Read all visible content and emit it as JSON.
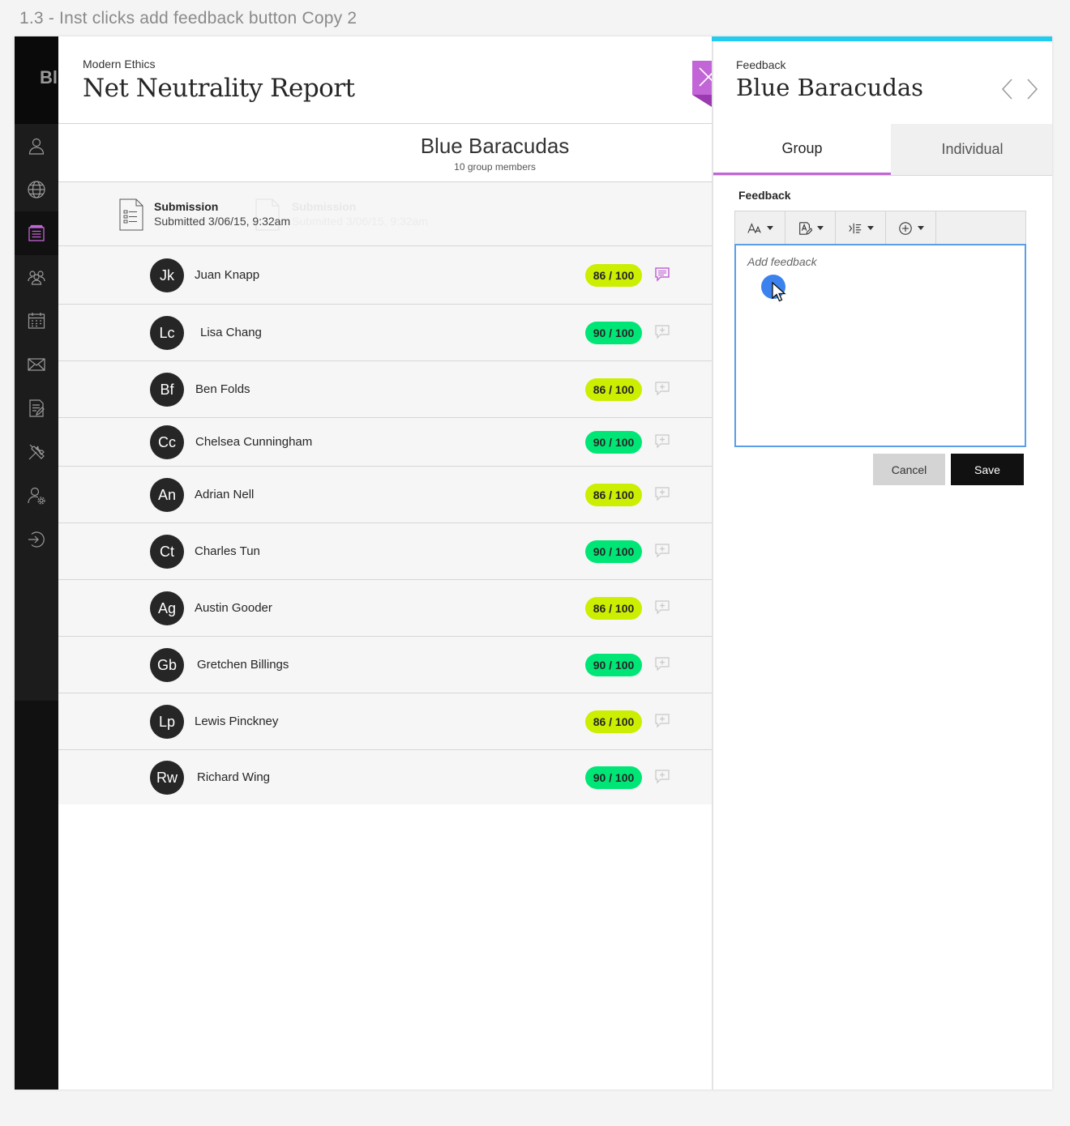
{
  "artboard": {
    "title": "1.3 - Inst clicks add feedback button Copy 2"
  },
  "nav": {
    "brand_text": "Bl",
    "items": [
      {
        "icon": "user-icon"
      },
      {
        "icon": "globe-icon"
      },
      {
        "icon": "courses-icon",
        "active": true
      },
      {
        "icon": "groups-icon"
      },
      {
        "icon": "calendar-icon"
      },
      {
        "icon": "mail-icon"
      },
      {
        "icon": "grades-icon"
      },
      {
        "icon": "tools-icon"
      },
      {
        "icon": "user-settings-icon"
      },
      {
        "icon": "sign-out-icon"
      }
    ]
  },
  "header": {
    "course": "Modern Ethics",
    "title": "Net Neutrality Report"
  },
  "group": {
    "name": "Blue Baracudas",
    "members": "10 group members"
  },
  "submission": {
    "title": "Submission",
    "date": "Submitted 3/06/15, 9:32am"
  },
  "students": [
    {
      "initials": "Jk",
      "name": "Juan Knapp",
      "grade": "86 / 100",
      "has_feedback": true
    },
    {
      "initials": "Lc",
      "name": "Lisa Chang",
      "grade": "90 / 100",
      "has_feedback": false
    },
    {
      "initials": "Bf",
      "name": "Ben Folds",
      "grade": "86 / 100",
      "has_feedback": false
    },
    {
      "initials": "Cc",
      "name": "Chelsea Cunningham",
      "grade": "90 / 100",
      "has_feedback": false
    },
    {
      "initials": "An",
      "name": "Adrian Nell",
      "grade": "86 / 100",
      "has_feedback": false
    },
    {
      "initials": "Ct",
      "name": "Charles Tun",
      "grade": "90 / 100",
      "has_feedback": false
    },
    {
      "initials": "Ag",
      "name": "Austin Gooder",
      "grade": "86 / 100",
      "has_feedback": false
    },
    {
      "initials": "Gb",
      "name": "Gretchen Billings",
      "grade": "90 / 100",
      "has_feedback": false
    },
    {
      "initials": "Lp",
      "name": "Lewis Pinckney",
      "grade": "86 / 100",
      "has_feedback": false
    },
    {
      "initials": "Rw",
      "name": "Richard Wing",
      "grade": "90 / 100",
      "has_feedback": false
    }
  ],
  "colors": {
    "grade_86": "#ccee00",
    "grade_90": "#00e676",
    "accent_purple": "#c265d6",
    "panel_top": "#22ccf0"
  },
  "panel": {
    "kicker": "Feedback",
    "title": "Blue Baracudas",
    "tabs": [
      "Group",
      "Individual"
    ],
    "active_tab": "Group",
    "feedback_label": "Feedback",
    "editor_placeholder": "Add feedback",
    "toolbar": [
      "text-size-icon",
      "text-style-icon",
      "paragraph-icon",
      "insert-icon"
    ],
    "cancel_label": "Cancel",
    "save_label": "Save"
  }
}
